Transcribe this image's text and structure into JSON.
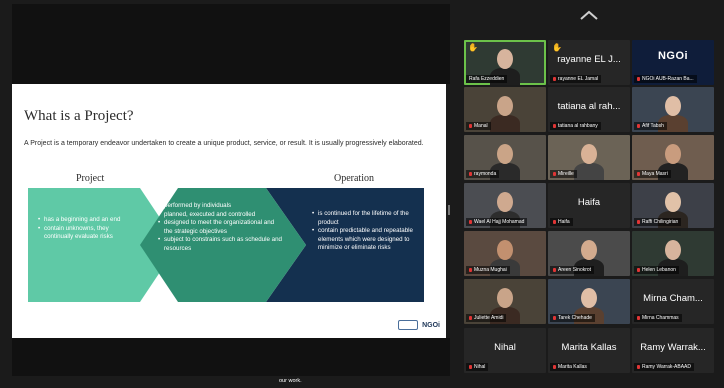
{
  "meeting": {
    "caption": "our work."
  },
  "slide": {
    "title": "What is a Project?",
    "definition": "A Project is a temporary endeavor undertaken to create a unique product,  service, or result. It is usually progressively elaborated.",
    "col_project": "Project",
    "col_operation": "Operation",
    "left_bullets": [
      "has a beginning and an end",
      "contain unknowns, they continually evaluate risks"
    ],
    "mid_bullets": [
      "performed by individuals",
      "planned, executed and controlled",
      "designed to meet the organizational and the strategic objectives",
      "subject to constrains such as schedule and resources"
    ],
    "right_bullets": [
      "is continued for the lifetime of the product",
      "contain predictable and repeatable elements which were designed to minimize or eliminate risks"
    ],
    "logo_text": "NGOi",
    "colors": {
      "light_green": "#5fc9a6",
      "mid_green": "#2f8f72",
      "navy": "#14304f"
    }
  },
  "participants": [
    {
      "id": "p1",
      "big": "",
      "label": "Rafa Ezzeddien",
      "hand": true,
      "active": true
    },
    {
      "id": "p2",
      "big": "rayanne EL J...",
      "label": "rayanne EL Jamal",
      "hand": true
    },
    {
      "id": "p3",
      "big": "",
      "label": "NGOi AUB-Razan Ba...",
      "logo": "NGOi"
    },
    {
      "id": "p4",
      "big": "",
      "label": "Manal"
    },
    {
      "id": "p5",
      "big": "tatiana al rah...",
      "label": "tatiana al rahbany"
    },
    {
      "id": "p6",
      "big": "",
      "label": "Afif Tabsh"
    },
    {
      "id": "p7",
      "big": "",
      "label": "raymonda"
    },
    {
      "id": "p8",
      "big": "",
      "label": "Mireille"
    },
    {
      "id": "p9",
      "big": "",
      "label": "Maya Masri"
    },
    {
      "id": "p10",
      "big": "",
      "label": "Wael Al Hajj Mohamad"
    },
    {
      "id": "p11",
      "big": "Haifa",
      "label": "Haifa"
    },
    {
      "id": "p12",
      "big": "",
      "label": "Raffi Chilingirian"
    },
    {
      "id": "p13",
      "big": "",
      "label": "Muzna Mughai"
    },
    {
      "id": "p14",
      "big": "",
      "label": "Areen Sinokrot"
    },
    {
      "id": "p15",
      "big": "",
      "label": "Helen Lebanon"
    },
    {
      "id": "p16",
      "big": "",
      "label": "Juliette Amidi"
    },
    {
      "id": "p17",
      "big": "",
      "label": "Tarek Chehade"
    },
    {
      "id": "p18",
      "big": "Mirna Cham...",
      "label": "Mirna Chammas"
    },
    {
      "id": "p19",
      "big": "Nihal",
      "label": "Nihal"
    },
    {
      "id": "p20",
      "big": "Marita Kallas",
      "label": "Marita Kallas"
    },
    {
      "id": "p21",
      "big": "Ramy Warrak...",
      "label": "Ramy Warrak-ABAAD"
    }
  ]
}
